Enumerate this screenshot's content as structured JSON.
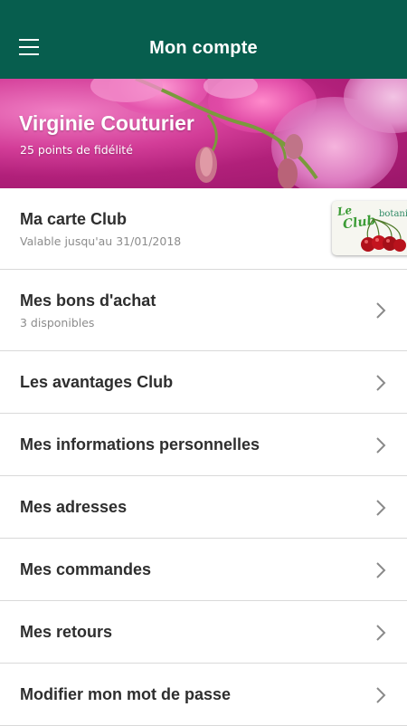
{
  "header": {
    "title": "Mon compte",
    "bar_color": "#075e4e",
    "menu_icon": "hamburger-menu-icon"
  },
  "profile": {
    "name": "Virginie Couturier",
    "points": "25 points de fidélité",
    "banner_image": "pink orchid photo"
  },
  "club_card": {
    "label": "Ma carte Club",
    "validity": "Valable jusqu'au 31/01/2018",
    "card_text_le": "Le",
    "card_text_club": "Club",
    "card_brand": "botanic"
  },
  "menu_items": [
    {
      "label": "Mes bons d'achat",
      "sub": "3 disponibles"
    },
    {
      "label": "Les avantages Club"
    },
    {
      "label": "Mes informations personnelles"
    },
    {
      "label": "Mes adresses"
    },
    {
      "label": "Mes commandes"
    },
    {
      "label": "Mes retours"
    },
    {
      "label": "Modifier mon mot de passe"
    }
  ]
}
